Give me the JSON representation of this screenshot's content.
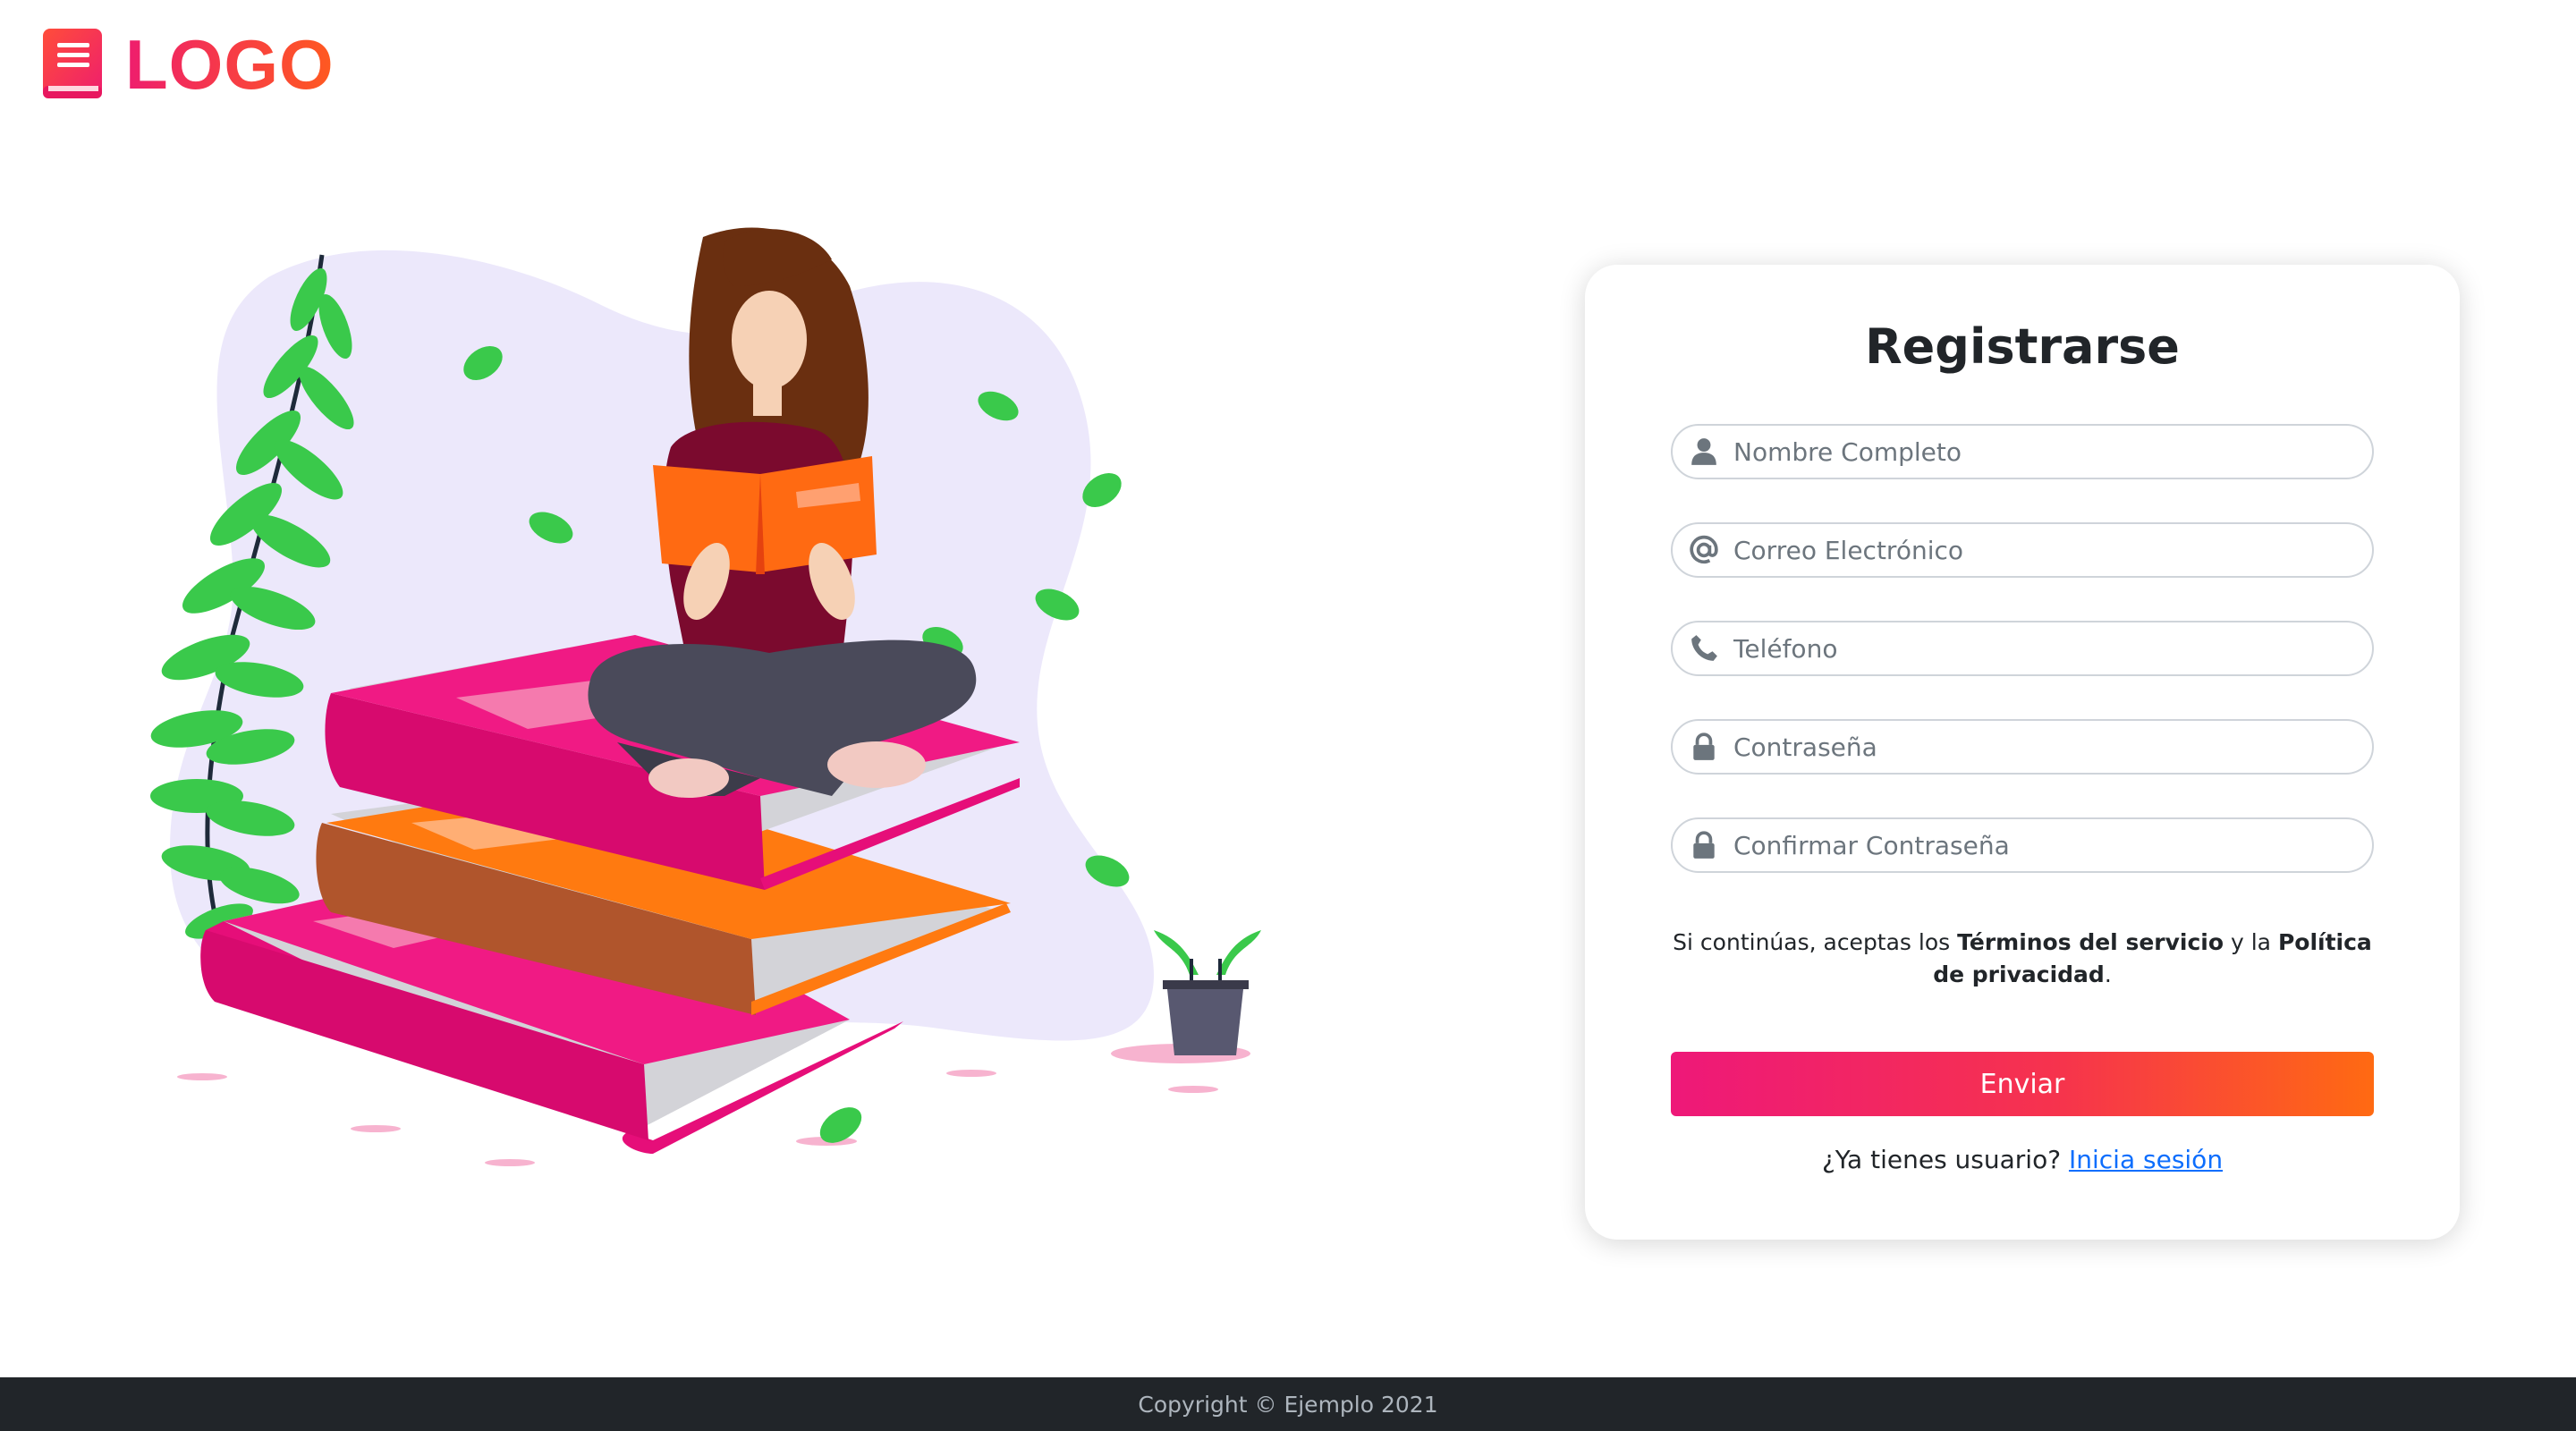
{
  "brand": {
    "logo_text": "LOGO",
    "gradient_start": "#ee1d6e",
    "gradient_end": "#ff5a1f",
    "icon": "book-icon"
  },
  "illustration": {
    "subject": "woman-reading-on-books"
  },
  "form": {
    "title": "Registrarse",
    "fields": [
      {
        "name": "full-name",
        "placeholder": "Nombre Completo",
        "icon": "user-icon"
      },
      {
        "name": "email",
        "placeholder": "Correo Electrónico",
        "icon": "at-icon"
      },
      {
        "name": "phone",
        "placeholder": "Teléfono",
        "icon": "phone-icon"
      },
      {
        "name": "password",
        "placeholder": "Contraseña",
        "icon": "lock-icon"
      },
      {
        "name": "confirm-password",
        "placeholder": "Confirmar Contraseña",
        "icon": "lock-icon"
      }
    ],
    "terms": {
      "prefix": "Si continúas, aceptas los ",
      "terms_link": "Términos del servicio",
      "middle": " y la ",
      "privacy_link": "Política de privacidad",
      "suffix": "."
    },
    "submit_label": "Enviar",
    "login_prompt": "¿Ya tienes usuario?",
    "login_link": "Inicia sesión"
  },
  "footer": {
    "copyright": "Copyright © Ejemplo 2021"
  },
  "colors": {
    "footer_bg": "#212529",
    "link": "#0d6efd",
    "button_start": "#ee1879",
    "button_end": "#ff6a12"
  }
}
